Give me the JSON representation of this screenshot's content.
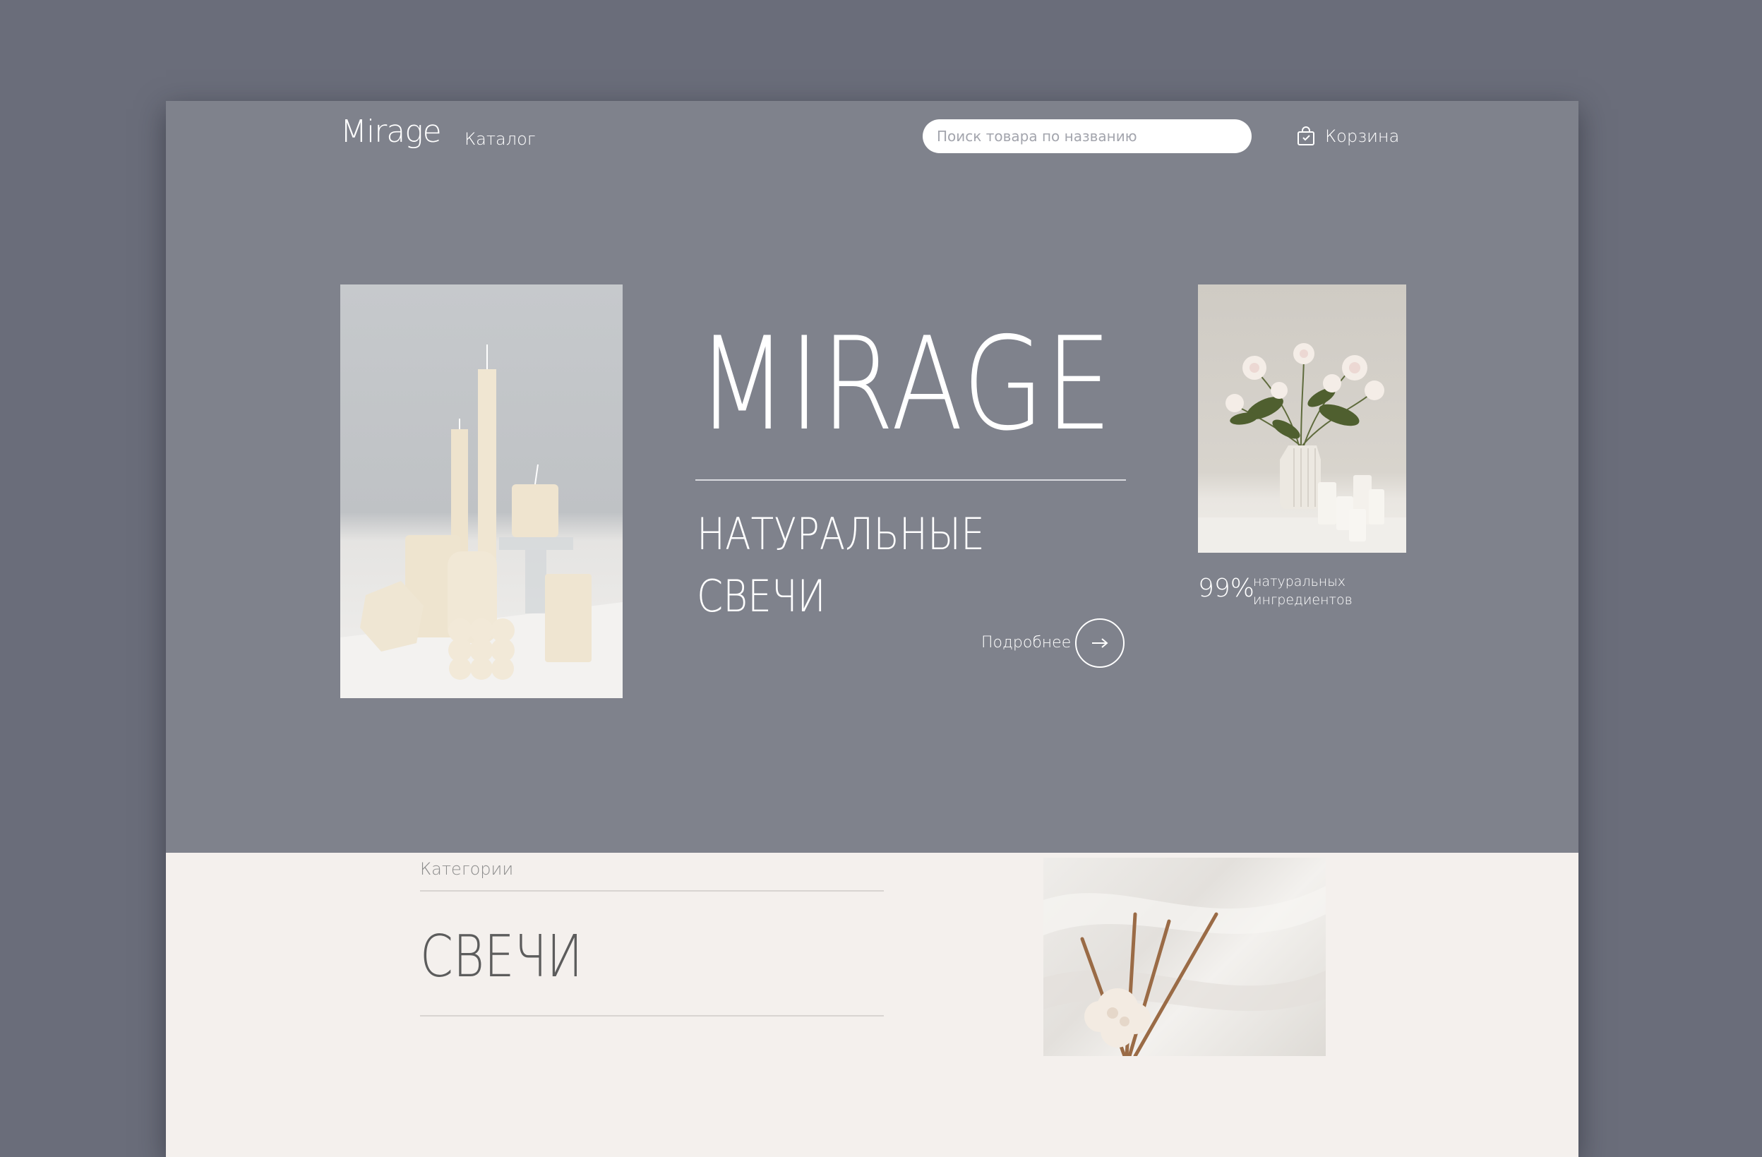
{
  "header": {
    "logo": "Mirage",
    "nav_catalog": "Каталог",
    "search_placeholder": "Поиск товара по названию",
    "cart_label": "Корзина"
  },
  "hero": {
    "title": "MIRAGE",
    "subtitle_line1": "НАТУРАЛЬНЫЕ",
    "subtitle_line2": "СВЕЧИ",
    "more_label": "Подробнее",
    "stat_value": "99%",
    "stat_label_line1": "натуральных",
    "stat_label_line2": "ингредиентов"
  },
  "categories": {
    "label": "Категории",
    "current": "СВЕЧИ"
  },
  "colors": {
    "outer_background": "#6a6d7a",
    "hero_background": "#7f828c",
    "lower_background": "#f4f0ed"
  },
  "icons": {
    "cart": "shopping-bag-icon",
    "more": "arrow-right-icon"
  }
}
